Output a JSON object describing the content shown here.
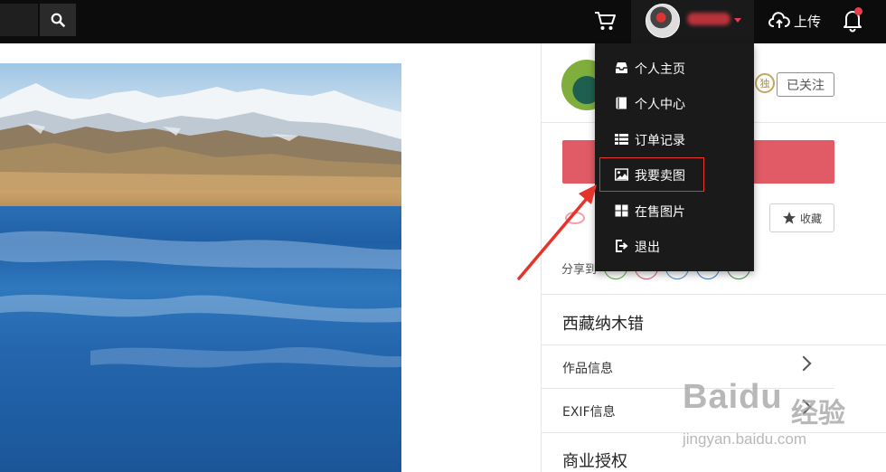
{
  "header": {
    "upload_label": "上传",
    "notification_dot_color": "#e83d4b"
  },
  "user_menu": {
    "items": [
      {
        "label": "个人主页",
        "icon": "inbox-icon"
      },
      {
        "label": "个人中心",
        "icon": "book-icon"
      },
      {
        "label": "订单记录",
        "icon": "list-icon"
      },
      {
        "label": "我要卖图",
        "icon": "image-icon"
      },
      {
        "label": "在售图片",
        "icon": "grid-icon"
      },
      {
        "label": "退出",
        "icon": "sign-out-icon"
      }
    ],
    "highlighted": "我要卖图"
  },
  "author": {
    "exclusive_badge": "独",
    "follow_label": "已关注"
  },
  "actions": {
    "favorite_label": "收藏",
    "share_label": "分享到",
    "buy_button_color": "#e15b66"
  },
  "photo": {
    "title": "西藏纳木错"
  },
  "info": {
    "work_info_label": "作品信息",
    "exif_label": "EXIF信息",
    "license_label": "商业授权"
  },
  "watermark": {
    "brand": "Baidu",
    "brand_cn": "经验",
    "url": "jingyan.baidu.com"
  },
  "colors": {
    "topbar": "#0c0c0c",
    "menu_bg": "#1a1a1a",
    "highlight_border": "#e5342b",
    "arrow": "#e5342b"
  }
}
